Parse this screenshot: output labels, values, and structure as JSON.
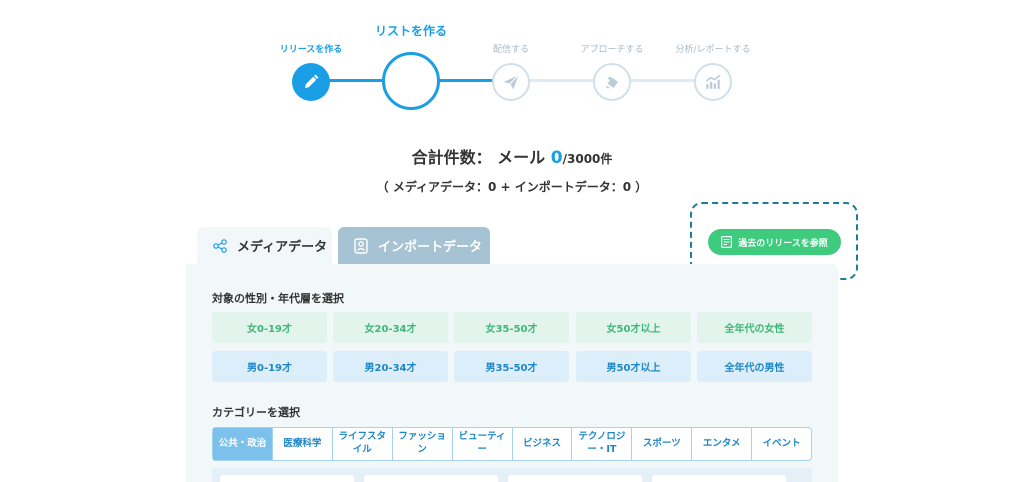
{
  "steps": [
    {
      "label": "リリースを作る",
      "state": "done",
      "icon": "pencil-icon"
    },
    {
      "label": "リストを作る",
      "state": "current",
      "icon": "list-icon"
    },
    {
      "label": "配信する",
      "state": "todo",
      "icon": "paper-plane-icon"
    },
    {
      "label": "アプローチする",
      "state": "todo",
      "icon": "hand-icon"
    },
    {
      "label": "分析/レポートする",
      "state": "todo",
      "icon": "chart-icon"
    }
  ],
  "total": {
    "prefix": "合計件数：",
    "type": "メール",
    "count": "0",
    "cap": "/3000件"
  },
  "breakdown": "（ メディアデータ：0 + インポートデータ：0 ）",
  "tabs": [
    {
      "label": "メディアデータ",
      "icon": "share-nodes-icon"
    },
    {
      "label": "インポートデータ",
      "icon": "contact-card-icon"
    }
  ],
  "history_button": "過去のリリースを参照",
  "demographic": {
    "title": "対象の性別・年代層を選択",
    "female": [
      "女0-19才",
      "女20-34才",
      "女35-50才",
      "女50才以上",
      "全年代の女性"
    ],
    "male": [
      "男0-19才",
      "男20-34才",
      "男35-50才",
      "男50才以上",
      "全年代の男性"
    ]
  },
  "category": {
    "title": "カテゴリーを選択",
    "items": [
      "公共・政治",
      "医療科学",
      "ライフスタ\nイル",
      "ファッショ\nン",
      "ビューティ\nー",
      "ビジネス",
      "テクノロジ\nー・IT",
      "スポーツ",
      "エンタメ",
      "イベント"
    ],
    "selected": "公共・政治"
  },
  "colors": {
    "primary": "#1a9ee6",
    "green": "#3ecb7e",
    "female_text": "#3eb878",
    "male_text": "#1d86c8",
    "dashed_border": "#1a7e96"
  }
}
